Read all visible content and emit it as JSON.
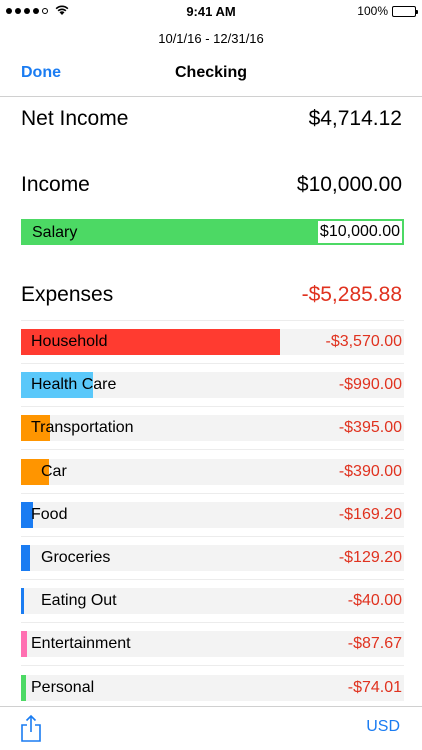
{
  "status_bar": {
    "time": "9:41 AM",
    "battery": "100%"
  },
  "header": {
    "date_range": "10/1/16 - 12/31/16",
    "done_label": "Done",
    "title": "Checking"
  },
  "net_income": {
    "label": "Net Income",
    "value": "$4,714.12"
  },
  "income": {
    "label": "Income",
    "value": "$10,000.00",
    "items": [
      {
        "label": "Salary",
        "value": "$10,000.00",
        "fraction": 1.0
      }
    ]
  },
  "expenses": {
    "label": "Expenses",
    "value": "-$5,285.88",
    "items": [
      {
        "label": "Household",
        "value": "-$3,570.00",
        "fraction": 0.675,
        "color": "#ff3b30",
        "indent": false
      },
      {
        "label": "Health Care",
        "value": "-$990.00",
        "fraction": 0.187,
        "color": "#5ac8fa",
        "indent": false
      },
      {
        "label": "Transportation",
        "value": "-$395.00",
        "fraction": 0.075,
        "color": "#ff9500",
        "indent": false
      },
      {
        "label": "Car",
        "value": "-$390.00",
        "fraction": 0.074,
        "color": "#ff9500",
        "indent": true
      },
      {
        "label": "Food",
        "value": "-$169.20",
        "fraction": 0.032,
        "color": "#1a7cf2",
        "indent": false
      },
      {
        "label": "Groceries",
        "value": "-$129.20",
        "fraction": 0.024,
        "color": "#1a7cf2",
        "indent": true
      },
      {
        "label": "Eating Out",
        "value": "-$40.00",
        "fraction": 0.0076,
        "color": "#1a7cf2",
        "indent": true
      },
      {
        "label": "Entertainment",
        "value": "-$87.67",
        "fraction": 0.0166,
        "color": "#ff6fb1",
        "indent": false
      },
      {
        "label": "Personal",
        "value": "-$74.01",
        "fraction": 0.014,
        "color": "#4cd964",
        "indent": false
      }
    ]
  },
  "toolbar": {
    "currency_label": "USD"
  },
  "colors": {
    "accent": "#1a7cf2",
    "negative": "#e0321f",
    "income_bar": "#4cd964"
  }
}
